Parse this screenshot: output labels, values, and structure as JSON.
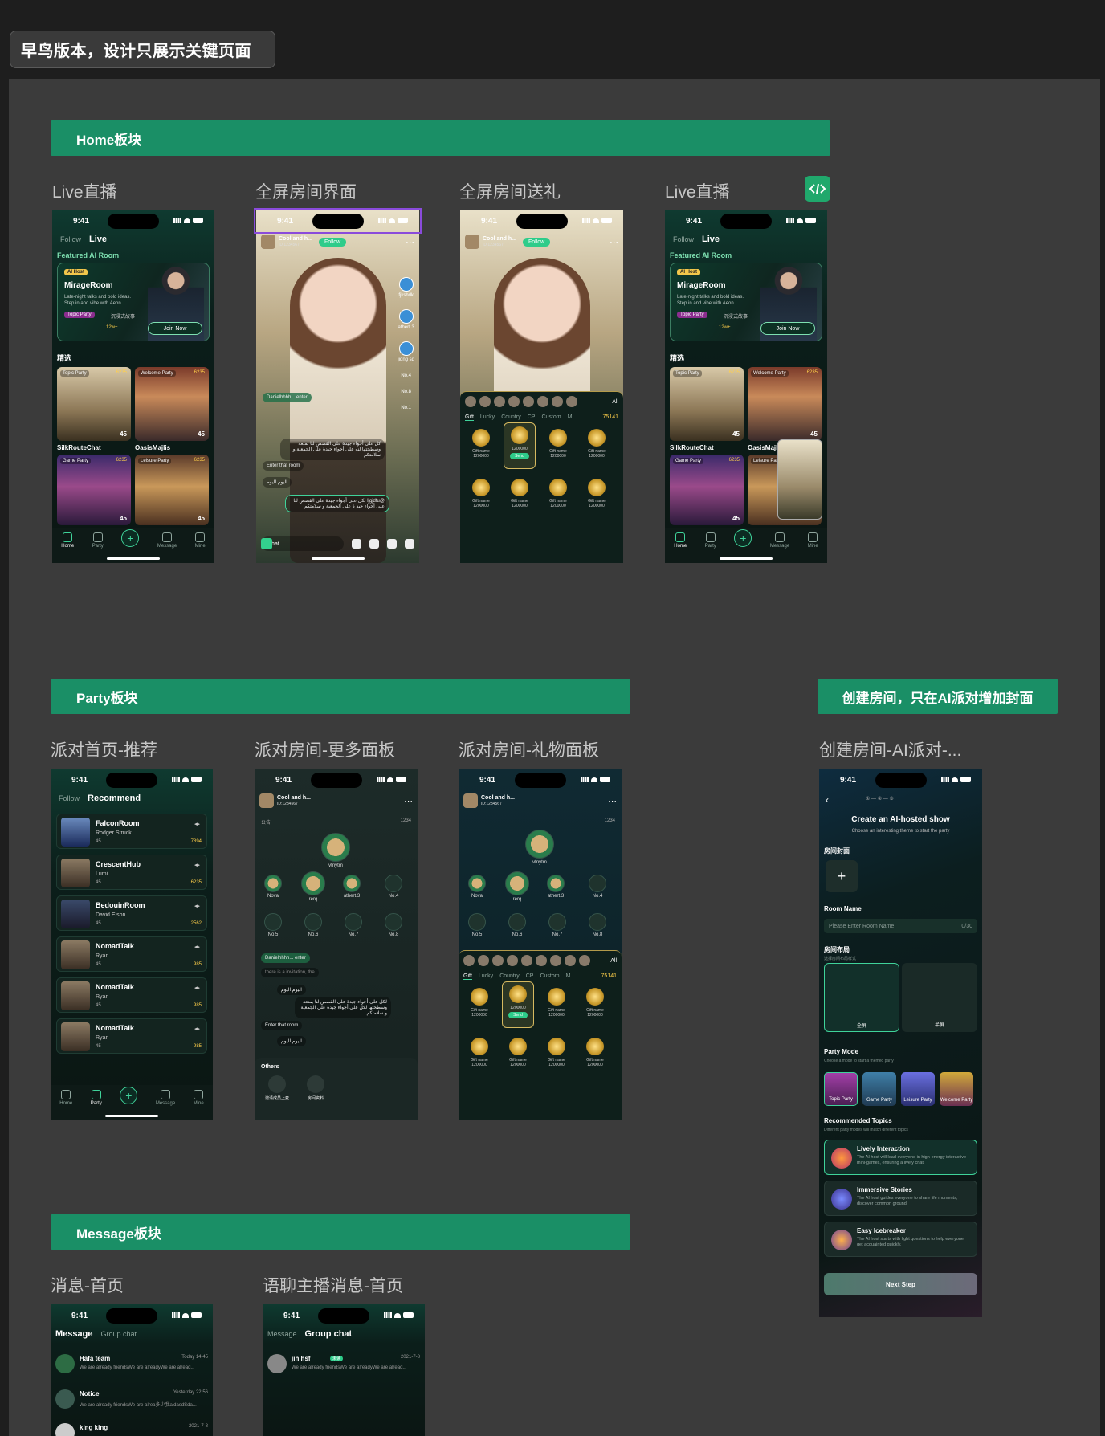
{
  "header": {
    "title": "早鸟版本，设计只展示关键页面"
  },
  "sections": {
    "home": "Home板块",
    "party": "Party板块",
    "create": "创建房间，只在AI派对增加封面",
    "message": "Message板块"
  },
  "labels": {
    "home1": "Live直播",
    "home2": "全屏房间界面",
    "home3": "全屏房间送礼",
    "home4": "Live直播",
    "party1": "派对首页-推荐",
    "party2": "派对房间-更多面板",
    "party3": "派对房间-礼物面板",
    "create1": "创建房间-AI派对-...",
    "msg1": "消息-首页",
    "msg2": "语聊主播消息-首页"
  },
  "status": {
    "time": "9:41"
  },
  "live": {
    "nav_follow": "Follow",
    "nav_live": "Live",
    "featured": "Featured AI Room",
    "hero_tag": "AI Host",
    "hero_name": "MirageRoom",
    "hero_desc": "Late-night talks and bold ideas. Step in and vibe with Aeon",
    "hero_party": "Topic Party",
    "hero_extra": "沉浸式故事",
    "hero_count": "12w+",
    "join": "Join Now",
    "section": "精选",
    "cards": [
      {
        "tag": "Topic Party",
        "count": "6235",
        "num": "45",
        "name": "SilkRouteChat"
      },
      {
        "tag": "Welcome Party",
        "count": "6235",
        "num": "45",
        "name": "OasisMajlis"
      },
      {
        "tag": "Game Party",
        "count": "6235",
        "num": "45",
        "name": ""
      },
      {
        "tag": "Leisure Party",
        "count": "6235",
        "num": "45",
        "name": ""
      }
    ],
    "tabs": [
      "Home",
      "Party",
      "Message",
      "Mine"
    ]
  },
  "room": {
    "name": "Cool and h...",
    "id": "ID:1234567",
    "follow": "Follow",
    "side_names": [
      "fjkshdk",
      "athert.3",
      "jidng sd",
      "No.4",
      "No.8",
      "No.1"
    ],
    "msg1": "Danielhhhh... enter",
    "msg2": "كل على أجواء جيدة على القصص لنا بمتعة وسطحتها لنه على أجواء جيدة على الجمعية و سلامتكم",
    "msg3": "Enter that room",
    "msg4": "اليوم اليوم",
    "msg5": "@ljgjdfu لكل على أجواء جيدة على القصص لنا على أجواء جيد ة على الجمعية و سلامتكم",
    "chat": "Chat",
    "count": "1234"
  },
  "giftpanel": {
    "all": "All",
    "tabs": [
      "Gift",
      "Lucky",
      "Country",
      "CP",
      "Custom",
      "M"
    ],
    "coins": "75141",
    "gift_name": "Gift name",
    "gift_price": "1200000",
    "send": "Send"
  },
  "partylist": {
    "nav_follow": "Follow",
    "nav_rec": "Recommend",
    "rows": [
      {
        "name": "FalconRoom",
        "user": "Rodger Struck",
        "num": "45",
        "count": "7894"
      },
      {
        "name": "CrescentHub",
        "user": "Lumi",
        "num": "45",
        "count": "6235"
      },
      {
        "name": "BedouinRoom",
        "user": "David Elson",
        "num": "45",
        "count": "2562"
      },
      {
        "name": "NomadTalk",
        "user": "Ryan",
        "num": "45",
        "count": "985"
      },
      {
        "name": "NomadTalk",
        "user": "Ryan",
        "num": "45",
        "count": "985"
      },
      {
        "name": "NomadTalk",
        "user": "Ryan",
        "num": "45",
        "count": "985"
      }
    ]
  },
  "partyroom": {
    "notice": "公告",
    "host": "vtnytm",
    "seats": [
      "Nova",
      "rerq",
      "athert.3",
      "No.4",
      "No.5",
      "No.6",
      "No.7",
      "No.8"
    ],
    "msg_enter": "Danielhhhh... enter",
    "msg_hint": "there is a invitation, the",
    "msg_user": "اليوم اليوم",
    "msg_text": "لكل على أجواء جيدة على القصص لنا بمتعة وسطحتها لكل على أجواء جيدة على الجمعية و سلامتكم",
    "msg_enter2": "Enter that room",
    "others": "Others",
    "opt1": "邀请成员上麦",
    "opt2": "房间资料"
  },
  "create": {
    "title": "Create an AI-hosted show",
    "sub": "Choose an interesting theme to start the party",
    "cover": "房间封面",
    "roomname": "Room Name",
    "placeholder": "Please Enter Room Name",
    "limit": "0/30",
    "layout": "房间布局",
    "layout_sub": "选择房间布局样式",
    "layout_a": "全屏",
    "layout_b": "半屏",
    "mode": "Party Mode",
    "mode_sub": "Choose a mode to start a themed party",
    "modes": [
      "Topic Party",
      "Game Party",
      "Leisure Party",
      "Welcome Party"
    ],
    "rec": "Recommended Topics",
    "rec_sub": "Different party modes will match different topics",
    "topics": [
      {
        "t": "Lively Interaction",
        "d": "The AI host will lead everyone in high-energy interactive mini-games, ensuring a lively chat."
      },
      {
        "t": "Immersive Stories",
        "d": "The AI host guides everyone to share life moments, discover common ground."
      },
      {
        "t": "Easy Icebreaker",
        "d": "The AI host starts with light questions to help everyone get acquainted quickly."
      }
    ],
    "next": "Next Step"
  },
  "messages": {
    "tab_msg": "Message",
    "tab_group": "Group chat",
    "rows": [
      {
        "name": "Hafa team",
        "time": "Today 14:45",
        "preview": "We are already friendsWe are alreadyWe are alread..."
      },
      {
        "name": "Notice",
        "time": "Yesterday 22:56",
        "preview": "We are already friendsWe are alrea多少我aidasdSda..."
      },
      {
        "name": "king king",
        "time": "2021-7-8",
        "preview": ""
      }
    ],
    "group_row": {
      "name": "jih hsf",
      "badge": "未读",
      "time": "2021-7-8",
      "preview": "We are already friendsWe are alreadyWe are alread..."
    }
  },
  "colors": {
    "accent": "#1a8f66",
    "select": "#8a4bdb"
  }
}
